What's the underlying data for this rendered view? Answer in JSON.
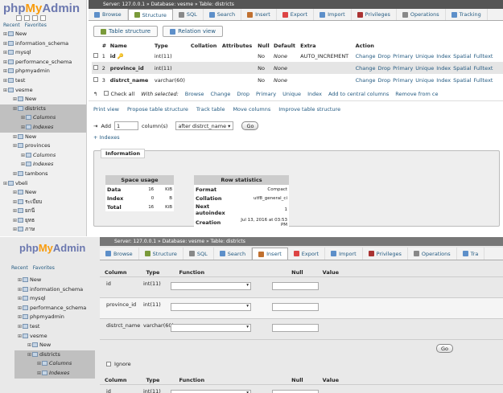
{
  "top": {
    "logo": {
      "php": "php",
      "my": "My",
      "admin": "Admin"
    },
    "sidebar_links": [
      "Recent",
      "Favorites"
    ],
    "tree": [
      {
        "label": "New",
        "style": "normal"
      },
      {
        "label": "information_schema",
        "style": "normal"
      },
      {
        "label": "mysql",
        "style": "normal"
      },
      {
        "label": "performance_schema",
        "style": "normal"
      },
      {
        "label": "phpmyadmin",
        "style": "normal"
      },
      {
        "label": "test",
        "style": "normal"
      },
      {
        "label": "vesme",
        "style": "normal"
      },
      {
        "label": "New",
        "style": "child"
      },
      {
        "label": "districts",
        "style": "sel"
      },
      {
        "label": "Columns",
        "style": "ital-sel"
      },
      {
        "label": "Indexes",
        "style": "ital-sel"
      },
      {
        "label": "New",
        "style": "child"
      },
      {
        "label": "provinces",
        "style": "child"
      },
      {
        "label": "Columns",
        "style": "ital"
      },
      {
        "label": "Indexes",
        "style": "ital"
      },
      {
        "label": "tambons",
        "style": "child"
      },
      {
        "label": "vbeli",
        "style": "normal"
      },
      {
        "label": "New",
        "style": "child"
      },
      {
        "label": "ระเบียบ",
        "style": "child"
      },
      {
        "label": "ยกนี",
        "style": "child"
      },
      {
        "label": "ยุทธ",
        "style": "child"
      },
      {
        "label": "ภาษ",
        "style": "child"
      }
    ],
    "breadcrumb": "Server: 127.0.0.1 » Database: vesme » Table: districts",
    "tabs": [
      {
        "label": "Browse",
        "color": "#5d8fc9"
      },
      {
        "label": "Structure",
        "color": "#7a9a3a",
        "active": true
      },
      {
        "label": "SQL",
        "color": "#888888"
      },
      {
        "label": "Search",
        "color": "#5d8fc9"
      },
      {
        "label": "Insert",
        "color": "#c07030"
      },
      {
        "label": "Export",
        "color": "#d44"
      },
      {
        "label": "Import",
        "color": "#5d8fc9"
      },
      {
        "label": "Privileges",
        "color": "#a33"
      },
      {
        "label": "Operations",
        "color": "#888888"
      },
      {
        "label": "Tracking",
        "color": "#5d8fc9"
      }
    ],
    "subtabs": [
      "Table structure",
      "Relation view"
    ],
    "columns": [
      "#",
      "Name",
      "Type",
      "Collation",
      "Attributes",
      "Null",
      "Default",
      "Extra",
      "Action"
    ],
    "rows": [
      {
        "num": "1",
        "name": "id",
        "type": "int(11)",
        "collation": "",
        "attributes": "",
        "null": "No",
        "default": "None",
        "extra": "AUTO_INCREMENT"
      },
      {
        "num": "2",
        "name": "province_id",
        "type": "int(11)",
        "collation": "",
        "attributes": "",
        "null": "No",
        "default": "None",
        "extra": ""
      },
      {
        "num": "3",
        "name": "distrct_name",
        "type": "varchar(60)",
        "collation": "",
        "attributes": "",
        "null": "No",
        "default": "None",
        "extra": ""
      }
    ],
    "row_actions": [
      "Change",
      "Drop",
      "Primary",
      "Unique",
      "Index",
      "Spatial",
      "Fulltext"
    ],
    "check_all": "Check all",
    "with_selected": "With selected:",
    "with_selected_actions": [
      "Browse",
      "Change",
      "Drop",
      "Primary",
      "Unique",
      "Index",
      "Add to central columns",
      "Remove from ce"
    ],
    "print_links": [
      "Print view",
      "Propose table structure",
      "Track table",
      "Move columns",
      "Improve table structure"
    ],
    "add_label": "Add",
    "add_value": "1",
    "add_unit": "column(s)",
    "add_position": "after distrct_name",
    "go_label": "Go",
    "indexes_link": "+ Indexes",
    "information_legend": "Information",
    "space_usage": {
      "header": "Space usage",
      "rows": [
        {
          "label": "Data",
          "value": "16",
          "unit": "KiB"
        },
        {
          "label": "Index",
          "value": "0",
          "unit": "B"
        },
        {
          "label": "Total",
          "value": "16",
          "unit": "KiB"
        }
      ]
    },
    "row_stats": {
      "header": "Row statistics",
      "rows": [
        {
          "label": "Format",
          "value": "Compact"
        },
        {
          "label": "Collation",
          "value": "utf8_general_ci"
        },
        {
          "label": "Next autoindex",
          "value": "1"
        },
        {
          "label": "Creation",
          "value": "Jul 13, 2016 at 03:53 PM"
        }
      ]
    }
  },
  "bottom": {
    "logo": {
      "php": "php",
      "my": "My",
      "admin": "Admin"
    },
    "sidebar_links": [
      "Recent",
      "Favorites"
    ],
    "tree": [
      "New",
      "information_schema",
      "mysql",
      "performance_schema",
      "phpmyadmin",
      "test",
      "vesme",
      "New",
      "districts",
      "Columns",
      "Indexes"
    ],
    "breadcrumb": "Server: 127.0.0.1 » Database: vesme » Table: districts",
    "tabs": [
      {
        "label": "Browse",
        "color": "#5d8fc9"
      },
      {
        "label": "Structure",
        "color": "#7a9a3a"
      },
      {
        "label": "SQL",
        "color": "#888888"
      },
      {
        "label": "Search",
        "color": "#5d8fc9"
      },
      {
        "label": "Insert",
        "color": "#c07030",
        "active": true
      },
      {
        "label": "Export",
        "color": "#d44"
      },
      {
        "label": "Import",
        "color": "#5d8fc9"
      },
      {
        "label": "Privileges",
        "color": "#a33"
      },
      {
        "label": "Operations",
        "color": "#888888"
      },
      {
        "label": "Tra",
        "color": "#5d8fc9"
      }
    ],
    "form_headers": [
      "Column",
      "Type",
      "Function",
      "Null",
      "Value"
    ],
    "form_rows": [
      {
        "column": "id",
        "type": "int(11)"
      },
      {
        "column": "province_id",
        "type": "int(11)"
      },
      {
        "column": "distrct_name",
        "type": "varchar(60)"
      }
    ],
    "go_label": "Go",
    "ignore_label": "Ignore",
    "form_rows_2": [
      {
        "column": "id",
        "type": "int(11)"
      }
    ]
  }
}
